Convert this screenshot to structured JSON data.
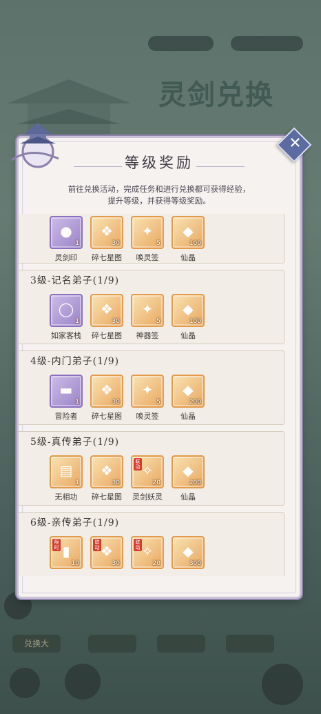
{
  "background": {
    "title": "灵剑兑换",
    "bottom_button": "兑换大"
  },
  "dialog": {
    "title": "等级奖励",
    "description_line1": "前往兑换活动，完成任务和进行兑换都可获得经验，",
    "description_line2": "提升等级，并获得等级奖励。",
    "close_symbol": "✕"
  },
  "rewards": [
    {
      "header": "",
      "items": [
        {
          "name": "灵剑印",
          "qty": "1",
          "style": "purple",
          "icon": "seal-icon",
          "tag": ""
        },
        {
          "name": "碎七星图",
          "qty": "30",
          "style": "gold",
          "icon": "scroll-icon",
          "tag": ""
        },
        {
          "name": "唤灵签",
          "qty": "5",
          "style": "gold",
          "icon": "talisman-icon",
          "tag": ""
        },
        {
          "name": "仙晶",
          "qty": "100",
          "style": "gold",
          "icon": "crystal-icon",
          "tag": ""
        }
      ]
    },
    {
      "header": "3级-记名弟子(1/9)",
      "items": [
        {
          "name": "如家客栈",
          "qty": "1",
          "style": "purple",
          "icon": "ring-icon",
          "tag": ""
        },
        {
          "name": "碎七星图",
          "qty": "30",
          "style": "gold",
          "icon": "scroll-icon",
          "tag": ""
        },
        {
          "name": "神器签",
          "qty": "5",
          "style": "gold",
          "icon": "talisman-icon",
          "tag": ""
        },
        {
          "name": "仙晶",
          "qty": "100",
          "style": "gold",
          "icon": "crystal-icon",
          "tag": ""
        }
      ]
    },
    {
      "header": "4级-内门弟子(1/9)",
      "items": [
        {
          "name": "冒险者",
          "qty": "1",
          "style": "purple",
          "icon": "plaque-icon",
          "tag": ""
        },
        {
          "name": "碎七星图",
          "qty": "30",
          "style": "gold",
          "icon": "scroll-icon",
          "tag": ""
        },
        {
          "name": "唤灵签",
          "qty": "5",
          "style": "gold",
          "icon": "talisman-icon",
          "tag": ""
        },
        {
          "name": "仙晶",
          "qty": "200",
          "style": "gold",
          "icon": "crystal-icon",
          "tag": ""
        }
      ]
    },
    {
      "header": "5级-真传弟子(1/9)",
      "items": [
        {
          "name": "无相功",
          "qty": "1",
          "style": "gold",
          "icon": "book-icon",
          "tag": ""
        },
        {
          "name": "碎七星图",
          "qty": "30",
          "style": "gold",
          "icon": "scroll-icon",
          "tag": ""
        },
        {
          "name": "灵剑妖灵",
          "qty": "20",
          "style": "gold",
          "icon": "spirit-icon",
          "tag": "联动"
        },
        {
          "name": "仙晶",
          "qty": "200",
          "style": "gold",
          "icon": "crystal-icon",
          "tag": ""
        }
      ]
    },
    {
      "header": "6级-亲传弟子(1/9)",
      "items": [
        {
          "name": "",
          "qty": "10",
          "style": "gold",
          "icon": "ticket-icon",
          "tag": "限时"
        },
        {
          "name": "",
          "qty": "30",
          "style": "gold",
          "icon": "scroll-icon",
          "tag": "联动"
        },
        {
          "name": "",
          "qty": "20",
          "style": "gold",
          "icon": "spirit-icon",
          "tag": "联动"
        },
        {
          "name": "",
          "qty": "300",
          "style": "gold",
          "icon": "crystal-icon",
          "tag": ""
        }
      ]
    }
  ],
  "icon_glyphs": {
    "seal-icon": "●",
    "scroll-icon": "❖",
    "talisman-icon": "✦",
    "crystal-icon": "◆",
    "ring-icon": "◯",
    "plaque-icon": "▬",
    "book-icon": "▤",
    "spirit-icon": "✧",
    "ticket-icon": "▮"
  }
}
